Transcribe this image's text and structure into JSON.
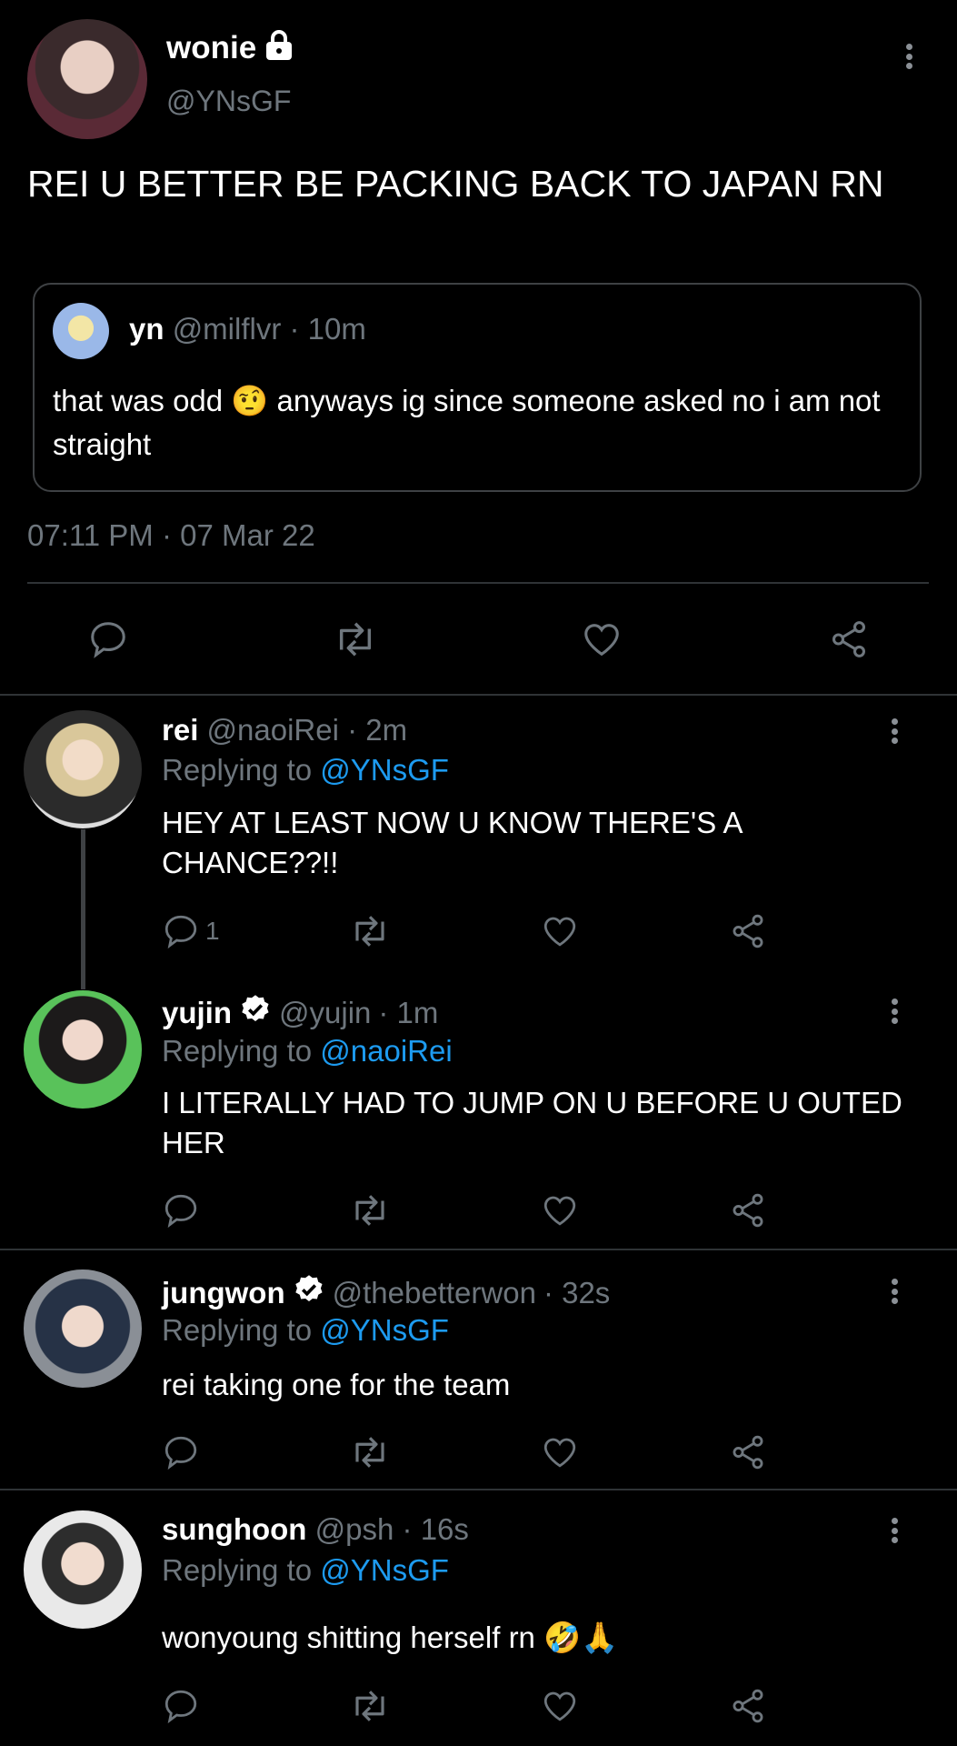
{
  "main_tweet": {
    "display_name": "wonie",
    "handle": "@YNsGF",
    "text": "REI U BETTER BE PACKING BACK TO JAPAN RN",
    "timestamp": "07:11 PM · 07 Mar 22",
    "locked_icon": "lock-icon",
    "quoted": {
      "display_name": "yn",
      "handle": "@milflvr",
      "time": "· 10m",
      "text": "that was odd 🤨 anyways ig since someone asked no i am not straight"
    }
  },
  "replies": [
    {
      "display_name": "rei",
      "handle": "@naoiRei",
      "time": "· 2m",
      "replying_prefix": "Replying to",
      "replying_to": "@YNsGF",
      "text": "HEY AT LEAST NOW U KNOW THERE'S A CHANCE??!!",
      "reply_count": "1",
      "verified": false
    },
    {
      "display_name": "yujin",
      "handle": "@yujin",
      "time": "· 1m",
      "replying_prefix": "Replying to",
      "replying_to": "@naoiRei",
      "text": "I LITERALLY HAD TO JUMP ON U BEFORE U OUTED HER",
      "reply_count": "",
      "verified": true
    },
    {
      "display_name": "jungwon",
      "handle": "@thebetterwon",
      "time": "· 32s",
      "replying_prefix": "Replying to",
      "replying_to": "@YNsGF",
      "text": "rei taking one for the team",
      "reply_count": "",
      "verified": true
    },
    {
      "display_name": "sunghoon",
      "handle": "@psh",
      "time": "· 16s",
      "replying_prefix": "Replying to",
      "replying_to": "@YNsGF",
      "text": "wonyoung shitting herself rn 🤣🙏",
      "reply_count": "",
      "verified": false
    }
  ],
  "colors": {
    "background": "#000000",
    "text": "#ffffff",
    "muted": "#6e767d",
    "link": "#1d9bf0",
    "border": "#2f3336"
  },
  "icons": [
    "reply-icon",
    "retweet-icon",
    "like-icon",
    "share-icon",
    "more-options-icon",
    "verified-badge-icon",
    "lock-icon"
  ]
}
